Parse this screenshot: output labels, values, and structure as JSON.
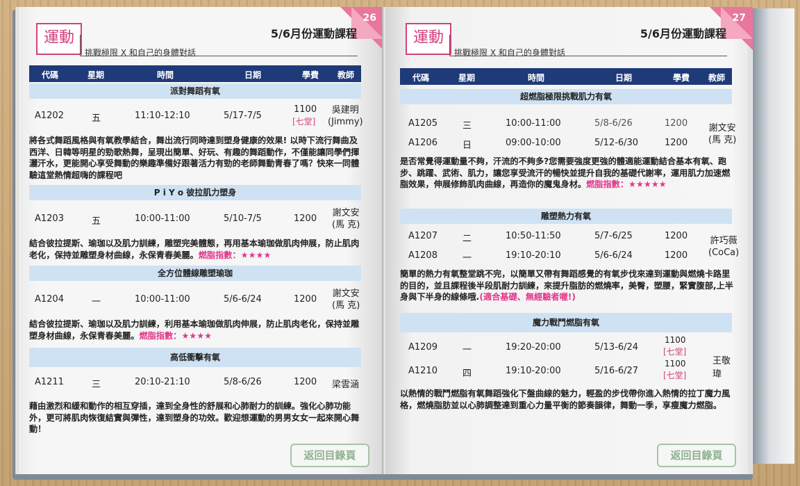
{
  "left": {
    "page_number": "26",
    "section": "運動",
    "subtitle": "挑戰極限 X 和自己的身體對話",
    "title": "5/6月份運動課程",
    "headers": [
      "代碼",
      "星期",
      "時間",
      "日期",
      "學費",
      "教師"
    ],
    "groups": [
      {
        "name": "派對舞蹈有氧",
        "rows": [
          {
            "code": "A1202",
            "day": "五",
            "time": "11:10-12:10",
            "date": "5/17-7/5",
            "fee": "1100",
            "fee_note": "[七堂]",
            "teacher": "吳建明\n(Jimmy)"
          }
        ],
        "desc": "將各式舞蹈風格與有氧教學結合，舞出流行同時達到塑身健康的效果! 以時下流行舞曲及西洋、日韓等明星的勁歌熱舞，呈現出簡單、好玩、有趣的舞蹈動作，不僅能讓同學們揮灑汗水，更能開心享受舞動的樂趣準備好跟著活力有勁的老師舞動青春了嗎？快來一同體驗這堂熱情超嗨的課程吧",
        "fat_index": ""
      },
      {
        "name": "P i Y o 彼拉肌力塑身",
        "rows": [
          {
            "code": "A1203",
            "day": "五",
            "time": "10:00-11:00",
            "date": "5/10-7/5",
            "fee": "1200",
            "fee_note": "",
            "teacher": "謝文安\n(馬 克)"
          }
        ],
        "desc": "結合彼拉提斯、瑜珈以及肌力訓練，雕塑完美體態，再用基本瑜珈做肌肉伸展，防止肌肉老化，保持並雕塑身材曲線，永保青春美麗。",
        "fat_index": "燃脂指數：★★★★"
      },
      {
        "name": "全方位體線雕塑瑜珈",
        "rows": [
          {
            "code": "A1204",
            "day": "一",
            "time": "10:00-11:00",
            "date": "5/6-6/24",
            "fee": "1200",
            "fee_note": "",
            "teacher": "謝文安\n(馬 克)"
          }
        ],
        "desc": "結合彼拉提斯、瑜珈以及肌力訓練，利用基本瑜珈做肌肉伸展，防止肌肉老化，保持並雕塑身材曲線，永保青春美麗。",
        "fat_index": "燃脂指數：★★★★"
      },
      {
        "name": "高低衝擊有氧",
        "rows": [
          {
            "code": "A1211",
            "day": "三",
            "time": "20:10-21:10",
            "date": "5/8-6/26",
            "fee": "1200",
            "fee_note": "",
            "teacher": "梁雲涵"
          }
        ],
        "desc": "藉由激烈和緩和動作的相互穿插，達到全身性的舒展和心肺耐力的訓練。強化心肺功能外，更可將肌肉恢復結實與彈性，達到塑身的功效。歡迎想運動的男男女女一起來開心舞動！",
        "fat_index": ""
      }
    ],
    "back_label": "返回目錄頁"
  },
  "right": {
    "page_number": "27",
    "section": "運動",
    "subtitle": "挑戰極限 X 和自己的身體對話",
    "title": "5/6月份運動課程",
    "headers": [
      "代碼",
      "星期",
      "時間",
      "日期",
      "學費",
      "教師"
    ],
    "groups": [
      {
        "name": "超燃脂極限挑戰肌力有氧",
        "rows": [
          {
            "code": "A1205",
            "day": "三",
            "time": "10:00-11:00",
            "date": "5/8-6/26",
            "fee": "1200",
            "fee_note": ""
          },
          {
            "code": "A1206",
            "day": "日",
            "time": "09:00-10:00",
            "date": "5/12-6/30",
            "fee": "1200",
            "fee_note": ""
          }
        ],
        "teacher": "謝文安\n(馬 克)",
        "desc": "是否常覺得運動量不夠，汗流的不夠多?您需要強度更強的體適能運動結合基本有氧、跑步、跳躍、武術、肌力，讓您享受流汗的暢快並提升自我的基礎代謝率，運用肌力加速燃脂效果，伸展修飾肌肉曲線，再造你的魔鬼身材。",
        "fat_index": "燃脂指數：★★★★★"
      },
      {
        "name": "雕塑熱力有氧",
        "rows": [
          {
            "code": "A1207",
            "day": "二",
            "time": "10:50-11:50",
            "date": "5/7-6/25",
            "fee": "1200",
            "fee_note": ""
          },
          {
            "code": "A1208",
            "day": "一",
            "time": "19:10-20:10",
            "date": "5/6-6/24",
            "fee": "1200",
            "fee_note": ""
          }
        ],
        "teacher": "許巧薇\n(CoCa)",
        "desc": "簡單的熱力有氧整堂跳不完，以簡單又帶有舞蹈感覺的有氧步伐來達到運動與燃燒卡路里的目的，並且課程後半段肌耐力訓練，來提升脂肪的燃燒率，美臀，塑腰，緊實腹部,上半身與下半身的線條哦.",
        "fat_index": "(適合基礎、無經驗者喔!)"
      },
      {
        "name": "魔力戰鬥燃脂有氧",
        "rows": [
          {
            "code": "A1209",
            "day": "一",
            "time": "19:20-20:00",
            "date": "5/13-6/24",
            "fee": "1100",
            "fee_note": "[七堂]"
          },
          {
            "code": "A1210",
            "day": "四",
            "time": "19:10-20:00",
            "date": "5/16-6/27",
            "fee": "1100",
            "fee_note": "[七堂]"
          }
        ],
        "teacher": "王敬瑋",
        "desc": "以熱情的戰鬥燃脂有氧舞蹈強化下盤曲線的魅力，輕盈的步伐帶你進入熱情的拉丁魔力風格，燃燒脂肪並以心肺調整達到重心力量平衡的節奏韻律，舞動一季，享瘦魔力燃脂。",
        "fat_index": ""
      }
    ],
    "back_label": "返回目錄頁"
  },
  "colors": {
    "accent": "#d2417d",
    "header": "#1f3a78",
    "band": "#cfe2f3",
    "corner": "#e8769d"
  }
}
